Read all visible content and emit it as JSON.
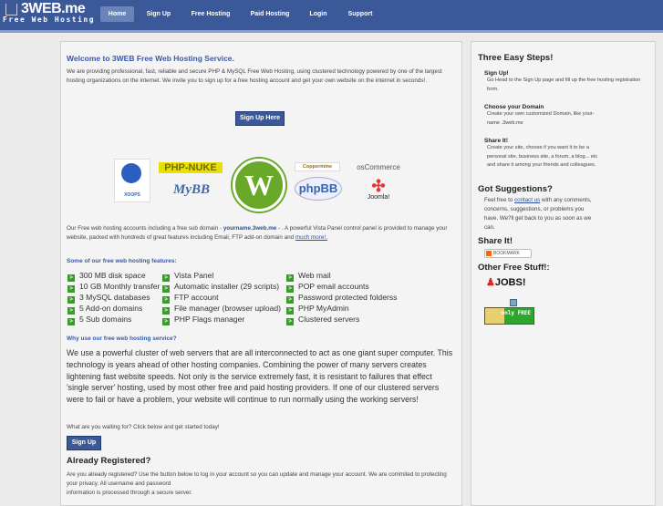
{
  "header": {
    "logo_title": "3WEB.me",
    "logo_subtitle": "Free Web Hosting",
    "nav": [
      "Home",
      "Sign Up",
      "Free Hosting",
      "Paid Hosting",
      "Login",
      "Support"
    ]
  },
  "main": {
    "title": "Welcome to 3WEB Free Web Hosting Service.",
    "intro": "We are providing professional, fast, reliable and secure PHP & MySQL Free Web Hosting, using clustered technology powered by one of the largest hosting organizations on the internet. We invite you to sign up for a free hosting account and get your own website on the internet in seconds!.",
    "signup_here": "Sign Up Here",
    "logos": [
      "XOOPS",
      "PHP-NUKE",
      "MyBB",
      "WordPress",
      "Coppermine",
      "osCommerce",
      "phpBB",
      "Joomla!"
    ],
    "sub_p1": "Our Free web hosting accounts including a free sub domain - ",
    "sub_domain": "yourname.3web.me",
    "sub_p2": " - . A powerful Vista Panel control panel is provided to manage your website, packed with hundreds of great features including Email, FTP add-on domain and ",
    "much_more": "much more!.",
    "features_heading": "Some of our free web hosting features:",
    "features": [
      [
        "300 MB disk space",
        "10 GB Monthly transfer",
        "3 MySQL databases",
        "5 Add-on domains",
        "5 Sub domains"
      ],
      [
        "Vista Panel",
        "Automatic installer (29 scripts)",
        "FTP account",
        "File manager (browser upload)",
        "PHP Flags manager"
      ],
      [
        "Web mail",
        "POP email accounts",
        "Password protected folderss",
        "PHP MyAdmin",
        "Clustered servers"
      ]
    ],
    "why_heading": "Why use our free web hosting service?",
    "why_text": "We use a powerful cluster of web servers that are all interconnected to act as one giant super computer. This technology is years ahead of other hosting companies. Combining the power of many servers creates lightening fast website speeds. Not only is the service extremely fast, it is resistant to failures that effect 'single server' hosting, used by most other free and paid hosting providers. If one of our clustered servers were to fail or have a problem, your website will continue to run normally using the working servers!",
    "waiting": "What are you waiting for? Click below and get started today!",
    "signup": "Sign Up",
    "already_heading": "Already Registered?",
    "already_text1": "Are you already registered? Use the button below to log in your account so you can update and manage your account. We are commited to protecting your privacy. All username and password",
    "already_text2": "information is processed through a secure server."
  },
  "sidebar": {
    "steps_heading": "Three Easy Steps!",
    "steps": [
      {
        "title": "Sign Up!",
        "text": "Go Head to the Sign Up page and fill up the free hosting registration form."
      },
      {
        "title": "Choose your Domain",
        "text": "Create your own customized Domain, like your-name .3web.me"
      },
      {
        "title": "Share It!",
        "text": "Create your site, choose if you want it to be a personal site, business site, a forum, a blog... etc and share it among your friends and colleagues."
      }
    ],
    "suggestions_heading": "Got Suggestions?",
    "sugg_1": "Feel free to ",
    "contact_us": "contact us",
    "sugg_2": " with any comments, concerns, suggestions, or problems you have. We?ll get back to you as soon as we can.",
    "share_heading": "Share It!",
    "bookmark": "BOOKMARK",
    "other_heading": "Other Free Stuff!:",
    "jobs": "JOBS!",
    "only_free": "only FREE"
  }
}
